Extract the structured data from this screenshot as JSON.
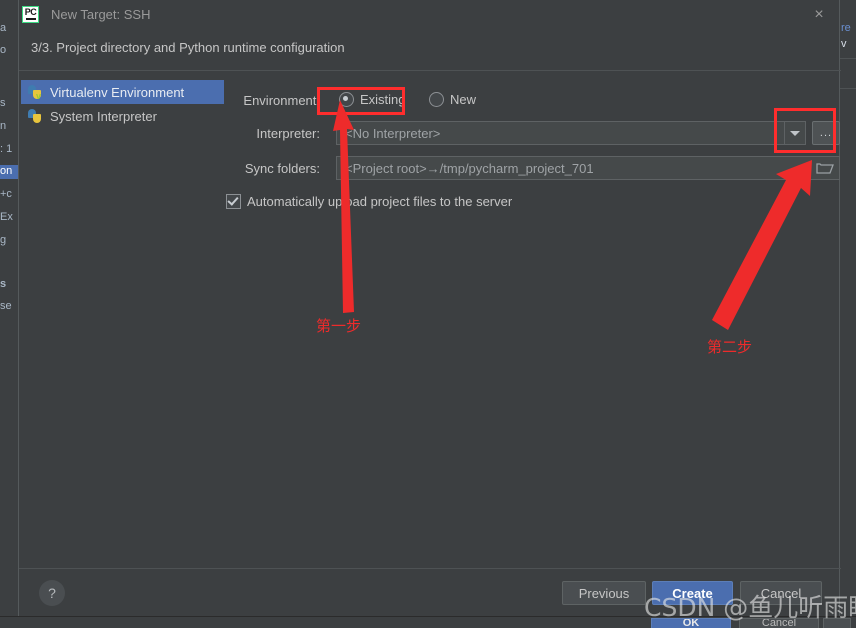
{
  "dialog": {
    "title": "New Target: SSH",
    "logo_text": "PC",
    "close_icon": "×",
    "step_line": "3/3. Project directory and Python runtime configuration"
  },
  "sidebar": {
    "items": [
      {
        "label": "Virtualenv Environment",
        "icon": "python-venv-icon",
        "selected": true
      },
      {
        "label": "System Interpreter",
        "icon": "python-icon",
        "selected": false
      }
    ]
  },
  "form": {
    "environment": {
      "label": "Environment:",
      "options": [
        {
          "label": "Existing",
          "selected": true
        },
        {
          "label": "New",
          "selected": false
        }
      ]
    },
    "interpreter": {
      "label": "Interpreter:",
      "value": "<No Interpreter>",
      "dropdown_icon": "chevron-down-icon",
      "browse_label": "..."
    },
    "sync_folders": {
      "label": "Sync folders:",
      "value": "<Project root>→/tmp/pycharm_project_701",
      "browse_icon": "folder-icon"
    },
    "auto_upload": {
      "label": "Automatically upload project files to the server",
      "checked": true
    }
  },
  "footer": {
    "help_label": "?",
    "previous_label": "Previous",
    "create_label": "Create",
    "cancel_label": "Cancel"
  },
  "background": {
    "ok_label": "OK",
    "cancel_label": "Cancel",
    "left_fragments": [
      "a",
      "o",
      "s",
      "n",
      ": 1",
      "on",
      "+c",
      "Ex",
      "g",
      "s",
      "se"
    ],
    "right_fragments": [
      "re",
      "v"
    ]
  },
  "annotations": {
    "step_one": "第一步",
    "step_two": "第二步",
    "watermark": "CSDN @鱼儿听雨眠",
    "highlight_color": "#ff2d2d"
  }
}
